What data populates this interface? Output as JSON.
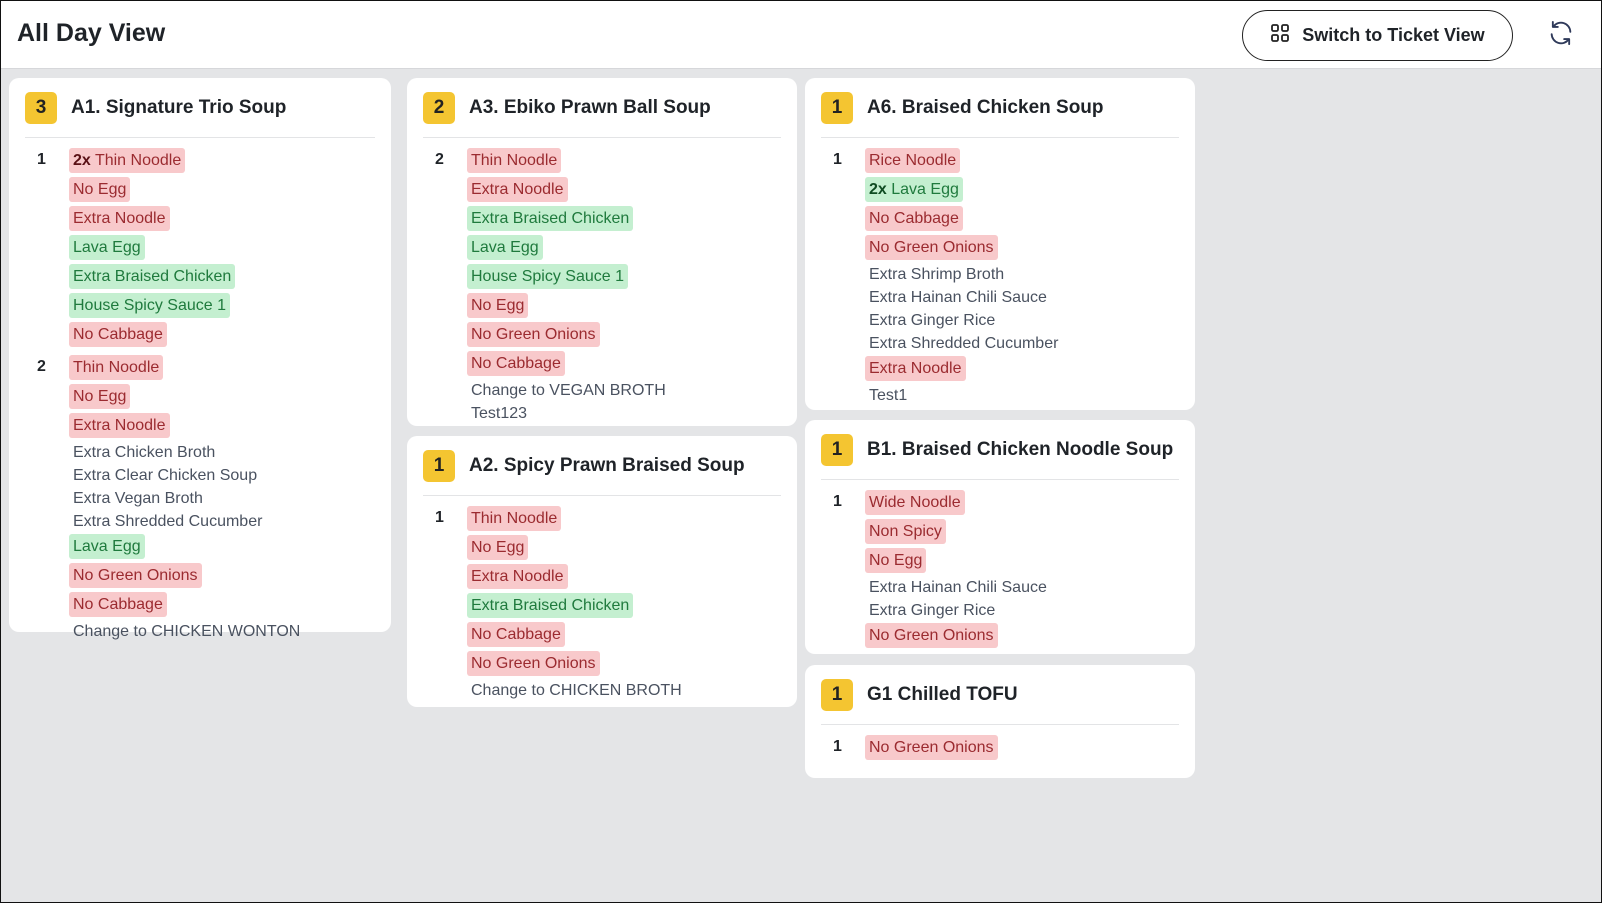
{
  "header": {
    "title": "All Day View",
    "switch_label": "Switch to Ticket View"
  },
  "cards": [
    {
      "qty": "3",
      "title": "A1. Signature Trio Soup",
      "orders": [
        {
          "num": "1",
          "mods": [
            {
              "prefix": "2x",
              "text": "Thin Noodle",
              "type": "red"
            },
            {
              "prefix": "",
              "text": "No Egg",
              "type": "red"
            },
            {
              "prefix": "",
              "text": "Extra Noodle",
              "type": "red"
            },
            {
              "prefix": "",
              "text": "Lava Egg",
              "type": "green"
            },
            {
              "prefix": "",
              "text": "Extra Braised Chicken",
              "type": "green"
            },
            {
              "prefix": "",
              "text": "House Spicy Sauce 1",
              "type": "green"
            },
            {
              "prefix": "",
              "text": "No Cabbage",
              "type": "red"
            }
          ]
        },
        {
          "num": "2",
          "mods": [
            {
              "prefix": "",
              "text": "Thin Noodle",
              "type": "red"
            },
            {
              "prefix": "",
              "text": "No Egg",
              "type": "red"
            },
            {
              "prefix": "",
              "text": "Extra Noodle",
              "type": "red"
            },
            {
              "prefix": "",
              "text": "Extra Chicken Broth",
              "type": "plain"
            },
            {
              "prefix": "",
              "text": "Extra Clear Chicken Soup",
              "type": "plain"
            },
            {
              "prefix": "",
              "text": "Extra Vegan Broth",
              "type": "plain"
            },
            {
              "prefix": "",
              "text": "Extra Shredded Cucumber",
              "type": "plain"
            },
            {
              "prefix": "",
              "text": "Lava Egg",
              "type": "green"
            },
            {
              "prefix": "",
              "text": "No Green Onions",
              "type": "red"
            },
            {
              "prefix": "",
              "text": "No Cabbage",
              "type": "red"
            },
            {
              "prefix": "",
              "text": "Change to CHICKEN WONTON",
              "type": "plain"
            }
          ]
        }
      ]
    },
    {
      "qty": "2",
      "title": "A3. Ebiko Prawn Ball Soup",
      "orders": [
        {
          "num": "2",
          "mods": [
            {
              "prefix": "",
              "text": "Thin Noodle",
              "type": "red"
            },
            {
              "prefix": "",
              "text": "Extra Noodle",
              "type": "red"
            },
            {
              "prefix": "",
              "text": "Extra Braised Chicken",
              "type": "green"
            },
            {
              "prefix": "",
              "text": "Lava Egg",
              "type": "green"
            },
            {
              "prefix": "",
              "text": "House Spicy Sauce 1",
              "type": "green"
            },
            {
              "prefix": "",
              "text": "No Egg",
              "type": "red"
            },
            {
              "prefix": "",
              "text": "No Green Onions",
              "type": "red"
            },
            {
              "prefix": "",
              "text": "No Cabbage",
              "type": "red"
            },
            {
              "prefix": "",
              "text": "Change to VEGAN BROTH",
              "type": "plain"
            },
            {
              "prefix": "",
              "text": "Test123",
              "type": "plain"
            }
          ]
        }
      ]
    },
    {
      "qty": "1",
      "title": "A2. Spicy Prawn Braised Soup",
      "orders": [
        {
          "num": "1",
          "mods": [
            {
              "prefix": "",
              "text": "Thin Noodle",
              "type": "red"
            },
            {
              "prefix": "",
              "text": "No Egg",
              "type": "red"
            },
            {
              "prefix": "",
              "text": "Extra Noodle",
              "type": "red"
            },
            {
              "prefix": "",
              "text": "Extra Braised Chicken",
              "type": "green"
            },
            {
              "prefix": "",
              "text": "No Cabbage",
              "type": "red"
            },
            {
              "prefix": "",
              "text": "No Green Onions",
              "type": "red"
            },
            {
              "prefix": "",
              "text": "Change to CHICKEN BROTH",
              "type": "plain"
            }
          ]
        }
      ]
    },
    {
      "qty": "1",
      "title": "A6. Braised Chicken Soup",
      "orders": [
        {
          "num": "1",
          "mods": [
            {
              "prefix": "",
              "text": "Rice Noodle",
              "type": "red"
            },
            {
              "prefix": "2x",
              "text": "Lava Egg",
              "type": "green"
            },
            {
              "prefix": "",
              "text": "No Cabbage",
              "type": "red"
            },
            {
              "prefix": "",
              "text": "No Green Onions",
              "type": "red"
            },
            {
              "prefix": "",
              "text": "Extra Shrimp Broth",
              "type": "plain"
            },
            {
              "prefix": "",
              "text": "Extra Hainan Chili Sauce",
              "type": "plain"
            },
            {
              "prefix": "",
              "text": "Extra Ginger Rice",
              "type": "plain"
            },
            {
              "prefix": "",
              "text": "Extra Shredded Cucumber",
              "type": "plain"
            },
            {
              "prefix": "",
              "text": "Extra Noodle",
              "type": "red"
            },
            {
              "prefix": "",
              "text": "Test1",
              "type": "plain"
            }
          ]
        }
      ]
    },
    {
      "qty": "1",
      "title": "B1. Braised Chicken Noodle Soup",
      "orders": [
        {
          "num": "1",
          "mods": [
            {
              "prefix": "",
              "text": "Wide Noodle",
              "type": "red"
            },
            {
              "prefix": "",
              "text": "Non Spicy",
              "type": "red"
            },
            {
              "prefix": "",
              "text": "No Egg",
              "type": "red"
            },
            {
              "prefix": "",
              "text": "Extra Hainan Chili Sauce",
              "type": "plain"
            },
            {
              "prefix": "",
              "text": "Extra Ginger Rice",
              "type": "plain"
            },
            {
              "prefix": "",
              "text": "No Green Onions",
              "type": "red"
            }
          ]
        }
      ]
    },
    {
      "qty": "1",
      "title": "G1 Chilled TOFU",
      "orders": [
        {
          "num": "1",
          "mods": [
            {
              "prefix": "",
              "text": "No Green Onions",
              "type": "red"
            }
          ]
        }
      ]
    }
  ]
}
